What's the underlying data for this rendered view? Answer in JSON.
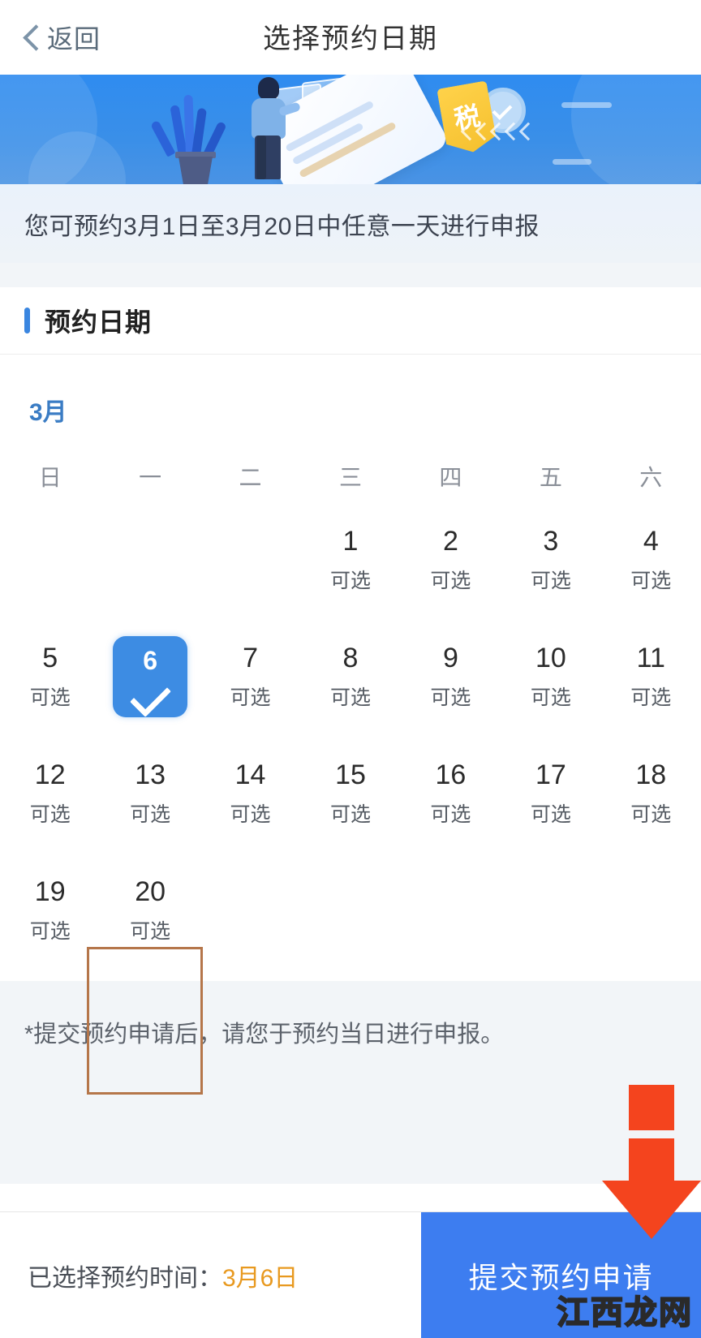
{
  "header": {
    "back_label": "返回",
    "title": "选择预约日期"
  },
  "banner": {
    "tax_badge": "税"
  },
  "notice": {
    "text": "您可预约3月1日至3月20日中任意一天进行申报"
  },
  "section": {
    "title": "预约日期"
  },
  "calendar": {
    "month_label": "3月",
    "weekdays": [
      "日",
      "一",
      "二",
      "三",
      "四",
      "五",
      "六"
    ],
    "available_label": "可选",
    "selected_day": "6",
    "weeks": [
      [
        {
          "day": "",
          "state": "empty"
        },
        {
          "day": "",
          "state": "empty"
        },
        {
          "day": "",
          "state": "empty"
        },
        {
          "day": "1",
          "state": "available",
          "sub": "可选"
        },
        {
          "day": "2",
          "state": "available",
          "sub": "可选"
        },
        {
          "day": "3",
          "state": "available",
          "sub": "可选"
        },
        {
          "day": "4",
          "state": "available",
          "sub": "可选"
        }
      ],
      [
        {
          "day": "5",
          "state": "available",
          "sub": "可选"
        },
        {
          "day": "6",
          "state": "selected",
          "sub": ""
        },
        {
          "day": "7",
          "state": "available",
          "sub": "可选"
        },
        {
          "day": "8",
          "state": "available",
          "sub": "可选"
        },
        {
          "day": "9",
          "state": "available",
          "sub": "可选"
        },
        {
          "day": "10",
          "state": "available",
          "sub": "可选"
        },
        {
          "day": "11",
          "state": "available",
          "sub": "可选"
        }
      ],
      [
        {
          "day": "12",
          "state": "available",
          "sub": "可选"
        },
        {
          "day": "13",
          "state": "available",
          "sub": "可选"
        },
        {
          "day": "14",
          "state": "available",
          "sub": "可选"
        },
        {
          "day": "15",
          "state": "available",
          "sub": "可选"
        },
        {
          "day": "16",
          "state": "available",
          "sub": "可选"
        },
        {
          "day": "17",
          "state": "available",
          "sub": "可选"
        },
        {
          "day": "18",
          "state": "available",
          "sub": "可选"
        }
      ],
      [
        {
          "day": "19",
          "state": "available",
          "sub": "可选"
        },
        {
          "day": "20",
          "state": "available",
          "sub": "可选"
        },
        {
          "day": "",
          "state": "empty"
        },
        {
          "day": "",
          "state": "empty"
        },
        {
          "day": "",
          "state": "empty"
        },
        {
          "day": "",
          "state": "empty"
        },
        {
          "day": "",
          "state": "empty"
        }
      ]
    ]
  },
  "note": {
    "text": "*提交预约申请后，请您于预约当日进行申报。"
  },
  "bottom": {
    "selected_prefix": "已选择预约时间：",
    "selected_value": "3月6日",
    "submit_label": "提交预约申请"
  },
  "watermark": {
    "text": "江西龙网"
  },
  "colors": {
    "primary_blue": "#3d7df0",
    "banner_blue": "#2f8cf0",
    "selected_chip": "#3d8ce3",
    "accent_orange": "#e8991f",
    "annotation_red": "#f4441e",
    "annotation_box": "#b5764a",
    "notice_bg": "#eaf2fb",
    "band_bg": "#f2f5f8"
  }
}
